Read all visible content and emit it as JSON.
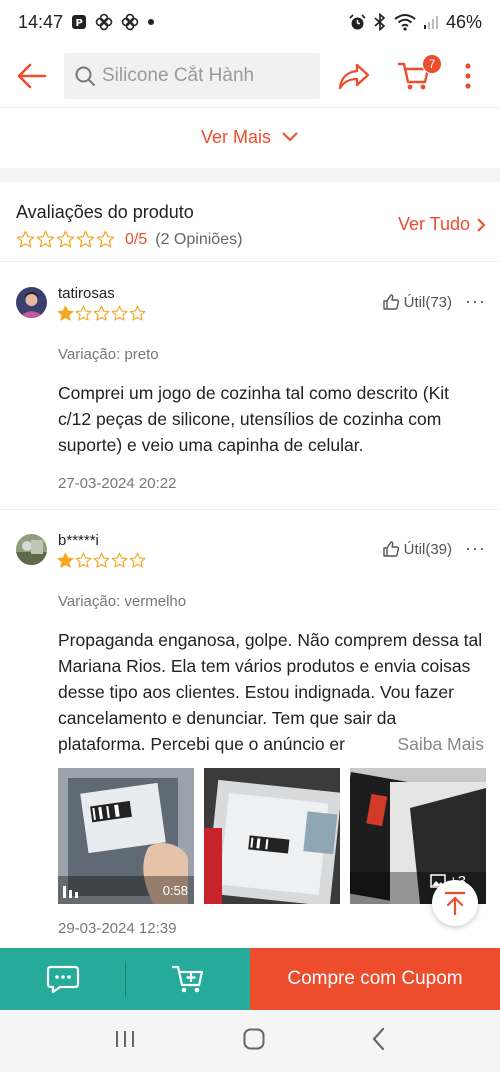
{
  "status_bar": {
    "time": "14:47",
    "battery": "46%"
  },
  "header": {
    "search_placeholder": "Silicone Cắt Hành",
    "cart_count": "7"
  },
  "ver_mais": "Ver Mais",
  "reviews": {
    "title": "Avaliações do produto",
    "score": "0/5",
    "count": "(2 Opiniões)",
    "see_all": "Ver Tudo",
    "items": [
      {
        "username": "tatirosas",
        "rating": 1,
        "helpful": "Útil(73)",
        "variation": "Variação: preto",
        "comment": "Comprei um jogo de cozinha tal como descrito (Kit c/12 peças de silicone, utensílios de cozinha com suporte) e veio uma capinha de celular.",
        "date": "27-03-2024 20:22"
      },
      {
        "username": "b*****i",
        "rating": 1,
        "helpful": "Útil(39)",
        "variation": "Variação: vermelho",
        "comment": "Propaganda enganosa, golpe. Não comprem dessa tal Mariana Rios. Ela tem vários produtos e envia coisas desse tipo aos clientes. Estou indignada. Vou fazer cancelamento e denunciar. Tem que sair da plataforma. Percebi que o anúncio er",
        "more": "Saiba Mais",
        "video_duration": "0:58",
        "extra_images": "+3",
        "date": "29-03-2024 12:39"
      }
    ]
  },
  "bottom_bar": {
    "buy_label": "Compre com Cupom"
  },
  "colors": {
    "accent": "#ee4d2d",
    "teal": "#26aa99",
    "star": "#f5a623"
  }
}
